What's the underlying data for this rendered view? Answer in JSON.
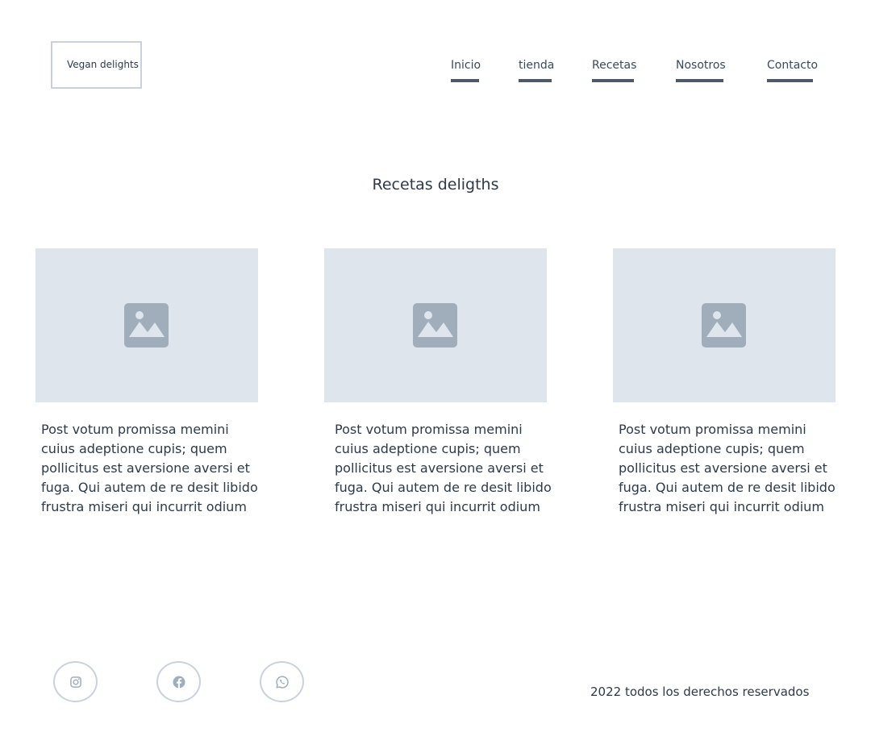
{
  "header": {
    "logo_text": "Vegan delights",
    "nav": [
      {
        "label": "Inicio"
      },
      {
        "label": "tienda"
      },
      {
        "label": "Recetas"
      },
      {
        "label": "Nosotros"
      },
      {
        "label": "Contacto"
      }
    ]
  },
  "main": {
    "title": "Recetas deligths",
    "cards": [
      {
        "image_icon": "image-placeholder-icon",
        "text": "Post votum promissa memini cuius adeptione cupis; quem pollicitus est aversione aversi et fuga. Qui autem de re desit libido frustra miseri qui incurrit odium"
      },
      {
        "image_icon": "image-placeholder-icon",
        "text": "Post votum promissa memini cuius adeptione cupis; quem pollicitus est aversione aversi et fuga. Qui autem de re desit libido frustra miseri qui incurrit odium"
      },
      {
        "image_icon": "image-placeholder-icon",
        "text": "Post votum promissa memini cuius adeptione cupis; quem pollicitus est aversione aversi et fuga. Qui autem de re desit libido frustra miseri qui incurrit odium"
      }
    ]
  },
  "footer": {
    "social": [
      {
        "icon": "instagram-icon"
      },
      {
        "icon": "facebook-icon"
      },
      {
        "icon": "whatsapp-icon"
      }
    ],
    "copyright": "2022 todos los derechos reservados"
  },
  "colors": {
    "text": "#2d3a4a",
    "nav_underline": "#4d5966",
    "image_placeholder_bg": "#dfe5ed",
    "image_icon": "#a0aebb",
    "border": "#c9d2dc"
  }
}
